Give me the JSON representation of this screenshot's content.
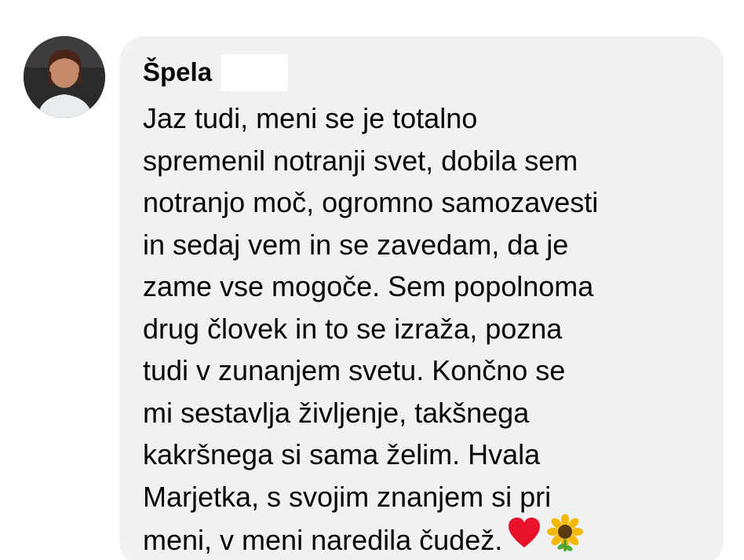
{
  "comment": {
    "author": "Špela",
    "text": "Jaz tudi, meni se je totalno\nspremenil notranji svet, dobila sem\nnotranjo moč, ogromno samozavesti\nin sedaj vem in se zavedam, da je\nzame vse mogoče. Sem popolnoma\ndrug človek in to se izraža, pozna\ntudi v zunanjem svetu. Končno se\nmi sestavlja življenje, takšnega\nkakršnega si sama želim. Hvala\nMarjetka, s svojim znanjem si pri\nmeni, v meni naredila čudež.",
    "emojis": [
      "heart-icon",
      "sunflower-icon"
    ]
  },
  "colors": {
    "bubble": "#f0f1f3",
    "text": "#050505",
    "heart": "#e8132b",
    "sunflower_petal": "#f5b800",
    "sunflower_center": "#5a3a16"
  }
}
